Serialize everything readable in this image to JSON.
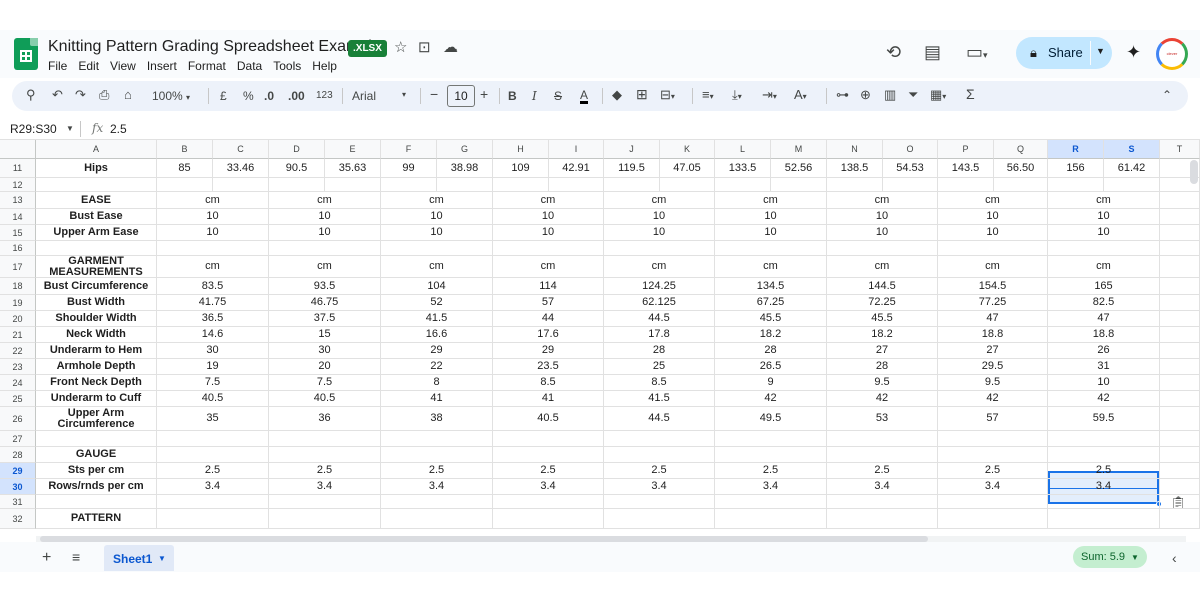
{
  "app": {
    "doc_title": "Knitting Pattern Grading Spreadsheet Example",
    "file_badge": ".XLSX",
    "menu": [
      "File",
      "Edit",
      "View",
      "Insert",
      "Format",
      "Data",
      "Tools",
      "Help"
    ],
    "share_label": "Share",
    "avatar_text": "clever creatives"
  },
  "toolbar": {
    "zoom": "100%",
    "currency": "£",
    "percent": "%",
    "dec_decrease": ".0",
    "dec_increase": ".00",
    "number_format": "123",
    "font": "Arial",
    "font_size": "10"
  },
  "formula_bar": {
    "name_box": "R29:S30",
    "fx": "fx",
    "value": "2.5"
  },
  "columns": [
    "A",
    "B",
    "C",
    "D",
    "E",
    "F",
    "G",
    "H",
    "I",
    "J",
    "K",
    "L",
    "M",
    "N",
    "O",
    "P",
    "Q",
    "R",
    "S",
    "T"
  ],
  "rows": [
    {
      "num": "11",
      "cells": [
        "Hips",
        "85",
        "33.46",
        "90.5",
        "35.63",
        "99",
        "38.98",
        "109",
        "42.91",
        "119.5",
        "47.05",
        "133.5",
        "52.56",
        "138.5",
        "54.53",
        "143.5",
        "56.50",
        "156",
        "61.42",
        ""
      ]
    },
    {
      "num": "12",
      "cells": [
        "",
        "",
        "",
        "",
        "",
        "",
        "",
        "",
        "",
        "",
        "",
        "",
        "",
        "",
        "",
        "",
        "",
        "",
        "",
        ""
      ]
    },
    {
      "num": "13",
      "cells": [
        "EASE",
        "cm",
        "",
        "cm",
        "",
        "cm",
        "",
        "cm",
        "",
        "cm",
        "",
        "cm",
        "",
        "cm",
        "",
        "cm",
        "",
        "cm",
        "",
        ""
      ]
    },
    {
      "num": "14",
      "cells": [
        "Bust Ease",
        "10",
        "",
        "10",
        "",
        "10",
        "",
        "10",
        "",
        "10",
        "",
        "10",
        "",
        "10",
        "",
        "10",
        "",
        "10",
        "",
        ""
      ]
    },
    {
      "num": "15",
      "cells": [
        "Upper Arm Ease",
        "10",
        "",
        "10",
        "",
        "10",
        "",
        "10",
        "",
        "10",
        "",
        "10",
        "",
        "10",
        "",
        "10",
        "",
        "10",
        "",
        ""
      ]
    },
    {
      "num": "16",
      "cells": [
        "",
        "",
        "",
        "",
        "",
        "",
        "",
        "",
        "",
        "",
        "",
        "",
        "",
        "",
        "",
        "",
        "",
        "",
        "",
        ""
      ]
    },
    {
      "num": "17",
      "cells": [
        "GARMENT MEASUREMENTS",
        "cm",
        "",
        "cm",
        "",
        "cm",
        "",
        "cm",
        "",
        "cm",
        "",
        "cm",
        "",
        "cm",
        "",
        "cm",
        "",
        "cm",
        "",
        ""
      ]
    },
    {
      "num": "18",
      "cells": [
        "Bust Circumference",
        "83.5",
        "",
        "93.5",
        "",
        "104",
        "",
        "114",
        "",
        "124.25",
        "",
        "134.5",
        "",
        "144.5",
        "",
        "154.5",
        "",
        "165",
        "",
        ""
      ]
    },
    {
      "num": "19",
      "cells": [
        "Bust Width",
        "41.75",
        "",
        "46.75",
        "",
        "52",
        "",
        "57",
        "",
        "62.125",
        "",
        "67.25",
        "",
        "72.25",
        "",
        "77.25",
        "",
        "82.5",
        "",
        ""
      ]
    },
    {
      "num": "20",
      "cells": [
        "Shoulder Width",
        "36.5",
        "",
        "37.5",
        "",
        "41.5",
        "",
        "44",
        "",
        "44.5",
        "",
        "45.5",
        "",
        "45.5",
        "",
        "47",
        "",
        "47",
        "",
        ""
      ]
    },
    {
      "num": "21",
      "cells": [
        "Neck Width",
        "14.6",
        "",
        "15",
        "",
        "16.6",
        "",
        "17.6",
        "",
        "17.8",
        "",
        "18.2",
        "",
        "18.2",
        "",
        "18.8",
        "",
        "18.8",
        "",
        ""
      ]
    },
    {
      "num": "22",
      "cells": [
        "Underarm to Hem",
        "30",
        "",
        "30",
        "",
        "29",
        "",
        "29",
        "",
        "28",
        "",
        "28",
        "",
        "27",
        "",
        "27",
        "",
        "26",
        "",
        ""
      ]
    },
    {
      "num": "23",
      "cells": [
        "Armhole Depth",
        "19",
        "",
        "20",
        "",
        "22",
        "",
        "23.5",
        "",
        "25",
        "",
        "26.5",
        "",
        "28",
        "",
        "29.5",
        "",
        "31",
        "",
        ""
      ]
    },
    {
      "num": "24",
      "cells": [
        "Front Neck Depth",
        "7.5",
        "",
        "7.5",
        "",
        "8",
        "",
        "8.5",
        "",
        "8.5",
        "",
        "9",
        "",
        "9.5",
        "",
        "9.5",
        "",
        "10",
        "",
        ""
      ]
    },
    {
      "num": "25",
      "cells": [
        "Underarm to Cuff",
        "40.5",
        "",
        "40.5",
        "",
        "41",
        "",
        "41",
        "",
        "41.5",
        "",
        "42",
        "",
        "42",
        "",
        "42",
        "",
        "42",
        "",
        ""
      ]
    },
    {
      "num": "26",
      "cells": [
        "Upper Arm Circumference",
        "35",
        "",
        "36",
        "",
        "38",
        "",
        "40.5",
        "",
        "44.5",
        "",
        "49.5",
        "",
        "53",
        "",
        "57",
        "",
        "59.5",
        "",
        ""
      ]
    },
    {
      "num": "27",
      "cells": [
        "",
        "",
        "",
        "",
        "",
        "",
        "",
        "",
        "",
        "",
        "",
        "",
        "",
        "",
        "",
        "",
        "",
        "",
        "",
        ""
      ]
    },
    {
      "num": "28",
      "cells": [
        "GAUGE",
        "",
        "",
        "",
        "",
        "",
        "",
        "",
        "",
        "",
        "",
        "",
        "",
        "",
        "",
        "",
        "",
        "",
        "",
        ""
      ]
    },
    {
      "num": "29",
      "cells": [
        "Sts per cm",
        "2.5",
        "",
        "2.5",
        "",
        "2.5",
        "",
        "2.5",
        "",
        "2.5",
        "",
        "2.5",
        "",
        "2.5",
        "",
        "2.5",
        "",
        "2.5",
        "",
        ""
      ]
    },
    {
      "num": "30",
      "cells": [
        "Rows/rnds per cm",
        "3.4",
        "",
        "3.4",
        "",
        "3.4",
        "",
        "3.4",
        "",
        "3.4",
        "",
        "3.4",
        "",
        "3.4",
        "",
        "3.4",
        "",
        "3.4",
        "",
        ""
      ]
    },
    {
      "num": "31",
      "cells": [
        "",
        "",
        "",
        "",
        "",
        "",
        "",
        "",
        "",
        "",
        "",
        "",
        "",
        "",
        "",
        "",
        "",
        "",
        "",
        ""
      ]
    },
    {
      "num": "32",
      "cells": [
        "PATTERN",
        "",
        "",
        "",
        "",
        "",
        "",
        "",
        "",
        "",
        "",
        "",
        "",
        "",
        "",
        "",
        "",
        "",
        "",
        ""
      ]
    }
  ],
  "selected_columns": [
    "R",
    "S"
  ],
  "selected_rows": [
    "29",
    "30"
  ],
  "bottom_bar": {
    "sheet_name": "Sheet1",
    "sum": "Sum: 5.9"
  },
  "colors": {
    "accent": "#0b57d0",
    "selection": "#1a73e8",
    "share_bg": "#c2e7ff",
    "sum_bg": "#c4eed0",
    "sheets_green": "#0f9d58"
  }
}
